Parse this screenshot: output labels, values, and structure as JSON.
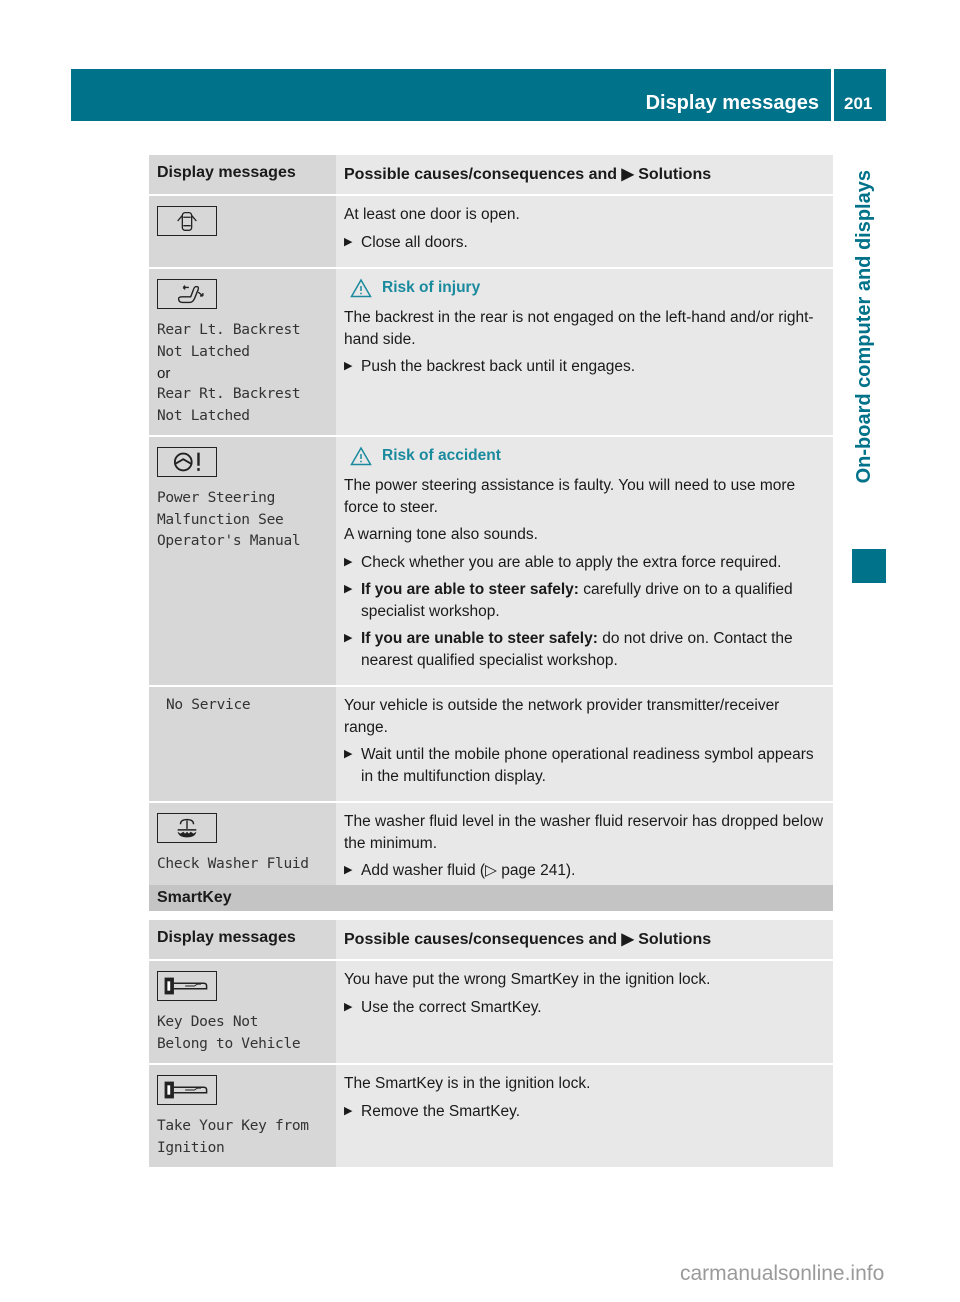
{
  "header": {
    "title": "Display messages",
    "page_number": "201",
    "side_tab": "On-board computer and displays",
    "brand_color": "#00728a"
  },
  "table1": {
    "columns": [
      "Display messages",
      "Possible causes/consequences and",
      "Solutions"
    ],
    "rows": [
      {
        "icon": "door-open-icon",
        "display": [],
        "content": {
          "texts": [
            "At least one door is open."
          ],
          "bullets": [
            {
              "lead": "",
              "text": "Close all doors."
            }
          ]
        }
      },
      {
        "icon": "rear-backrest-icon",
        "display": [
          "Rear Lt. Backrest",
          "Not Latched"
        ],
        "or": "or",
        "display2": [
          "Rear Rt. Backrest",
          "Not Latched"
        ],
        "content": {
          "warning": "Risk of injury",
          "texts": [
            "The backrest in the rear is not engaged on the left-hand and/or right-hand side."
          ],
          "bullets": [
            {
              "lead": "",
              "text": "Push the backrest back until it engages."
            }
          ]
        }
      },
      {
        "icon": "power-steering-warning-icon",
        "display": [
          "Power Steering",
          "Malfunction See",
          "Operator's Manual"
        ],
        "content": {
          "warning": "Risk of accident",
          "texts": [
            "The power steering assistance is faulty. You will need to use more force to steer.",
            "A warning tone also sounds."
          ],
          "bullets": [
            {
              "lead": "",
              "text": "Check whether you are able to apply the extra force required."
            },
            {
              "lead": "If you are able to steer safely:",
              "text": " carefully drive on to a qualified specialist workshop."
            },
            {
              "lead": "If you are unable to steer safely:",
              "text": " do not drive on. Contact the nearest qualified specialist workshop."
            }
          ]
        }
      },
      {
        "icon": "",
        "display": [
          "No Service"
        ],
        "content": {
          "texts": [
            "Your vehicle is outside the network provider transmitter/receiver range."
          ],
          "bullets": [
            {
              "lead": "",
              "text": "Wait until the mobile phone operational readiness symbol appears in the multifunction display."
            }
          ]
        }
      },
      {
        "icon": "washer-fluid-icon",
        "display": [
          "Check Washer Fluid"
        ],
        "content": {
          "texts": [
            "The washer fluid level in the washer fluid reservoir has dropped below the minimum."
          ],
          "bullets": [
            {
              "lead": "",
              "text": "Add washer fluid (▷ page 241)."
            }
          ]
        }
      }
    ]
  },
  "smartkey_section": {
    "title": "SmartKey",
    "columns": [
      "Display messages",
      "Possible causes/consequences and",
      "Solutions"
    ],
    "rows": [
      {
        "icon": "smartkey-icon",
        "display": [
          "Key Does Not",
          "Belong to Vehicle"
        ],
        "content": {
          "texts": [
            "You have put the wrong SmartKey in the ignition lock."
          ],
          "bullets": [
            {
              "lead": "",
              "text": "Use the correct SmartKey."
            }
          ]
        }
      },
      {
        "icon": "smartkey-icon",
        "display": [
          "Take Your Key from",
          "Ignition"
        ],
        "content": {
          "texts": [
            "The SmartKey is in the ignition lock."
          ],
          "bullets": [
            {
              "lead": "",
              "text": "Remove the SmartKey."
            }
          ]
        }
      }
    ]
  },
  "watermark": "carmanualsonline.info",
  "bullet_glyph": "▶"
}
